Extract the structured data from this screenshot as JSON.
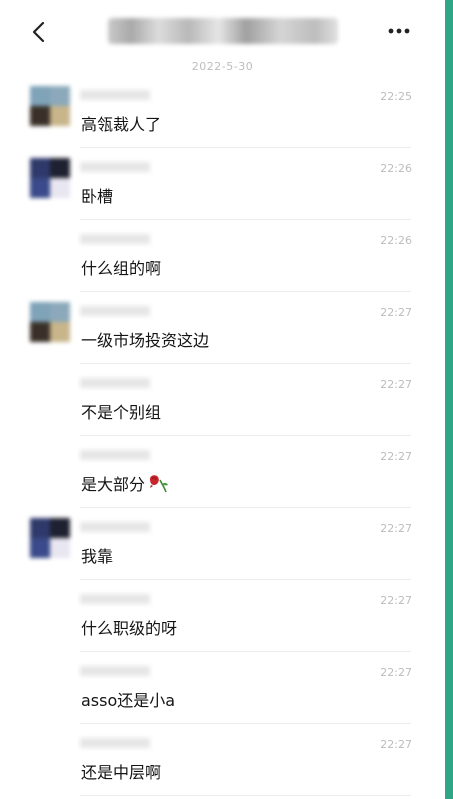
{
  "header": {
    "title": "████ ████ ████",
    "back_icon": "chevron-left-icon",
    "more_icon": "more-dots-icon"
  },
  "date_label": "2022-5-30",
  "colors": {
    "accent": "#2fa786",
    "divider": "#ececec",
    "muted": "#bdbdbd"
  },
  "messages": [
    {
      "sender": "████",
      "time": "22:25",
      "text": "高瓴裁人了",
      "avatar": "blurred-avatar-a"
    },
    {
      "sender": "████",
      "time": "22:26",
      "text": "卧槽",
      "avatar": "blurred-avatar-b"
    },
    {
      "sender": "████",
      "time": "22:26",
      "text": "什么组的啊",
      "avatar": ""
    },
    {
      "sender": "████",
      "time": "22:27",
      "text": "一级市场投资这边",
      "avatar": "blurred-avatar-a"
    },
    {
      "sender": "████",
      "time": "22:27",
      "text": "不是个别组",
      "avatar": ""
    },
    {
      "sender": "████",
      "time": "22:27",
      "text": "是大部分",
      "avatar": "",
      "emoji": "wilted-rose-icon"
    },
    {
      "sender": "████",
      "time": "22:27",
      "text": "我靠",
      "avatar": "blurred-avatar-b"
    },
    {
      "sender": "████",
      "time": "22:27",
      "text": "什么职级的呀",
      "avatar": ""
    },
    {
      "sender": "████",
      "time": "22:27",
      "text": "asso还是小a",
      "avatar": ""
    },
    {
      "sender": "████",
      "time": "22:27",
      "text": "还是中层啊",
      "avatar": ""
    }
  ]
}
